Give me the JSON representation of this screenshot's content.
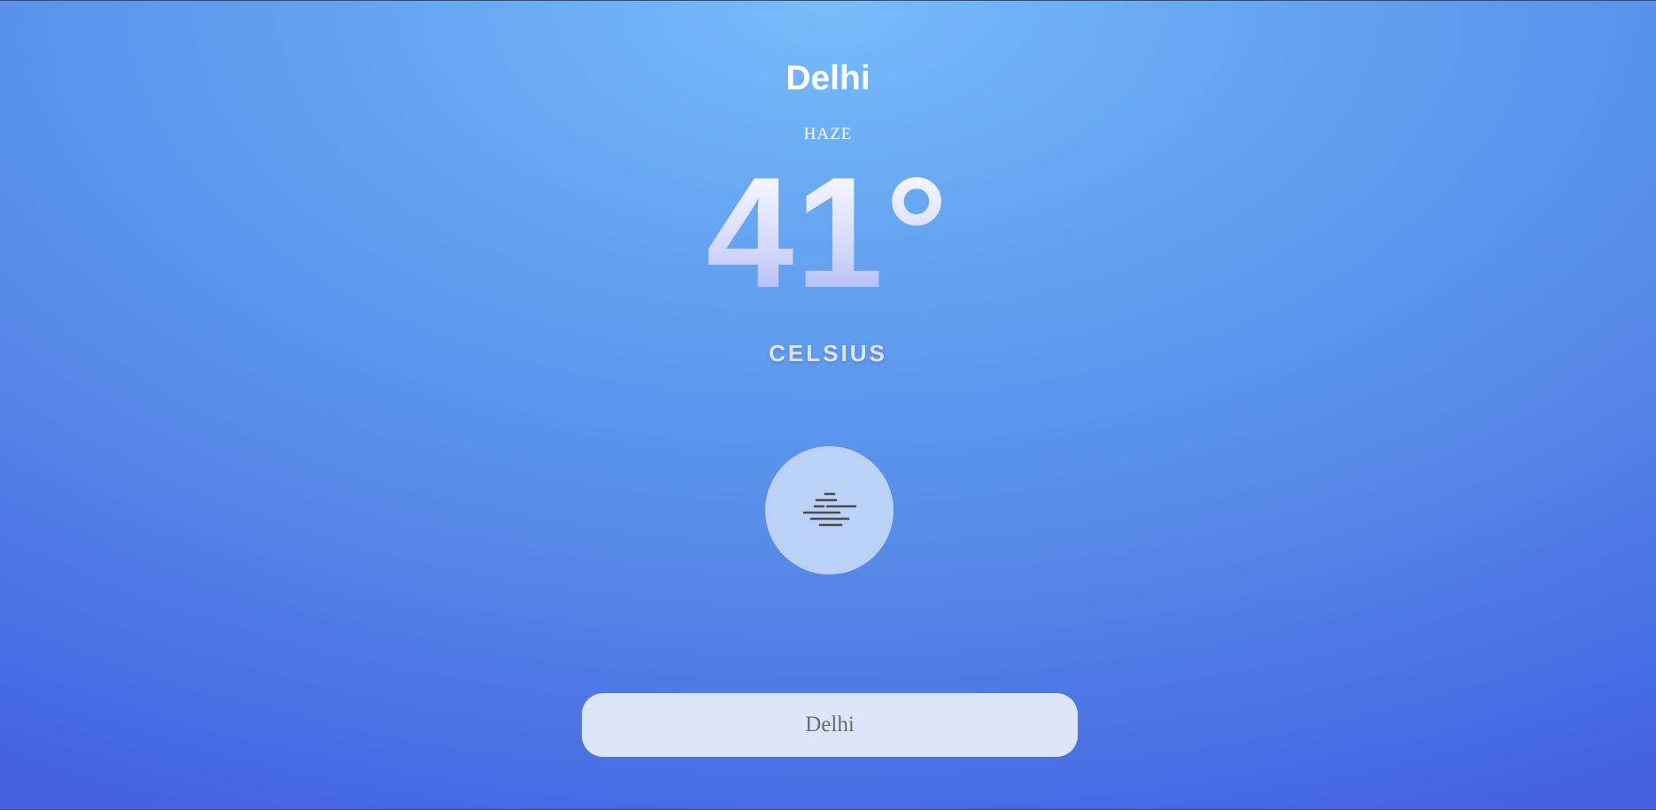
{
  "weather": {
    "city": "Delhi",
    "condition": "HAZE",
    "temperature": "41°",
    "unit": "CELSIUS",
    "icon": "haze-icon"
  },
  "search": {
    "value": "Delhi"
  },
  "colors": {
    "background_top": "#78bcfa",
    "background_bottom": "#4462e2",
    "icon_circle": "#bcd1f6",
    "input_background": "#dce5fa"
  }
}
